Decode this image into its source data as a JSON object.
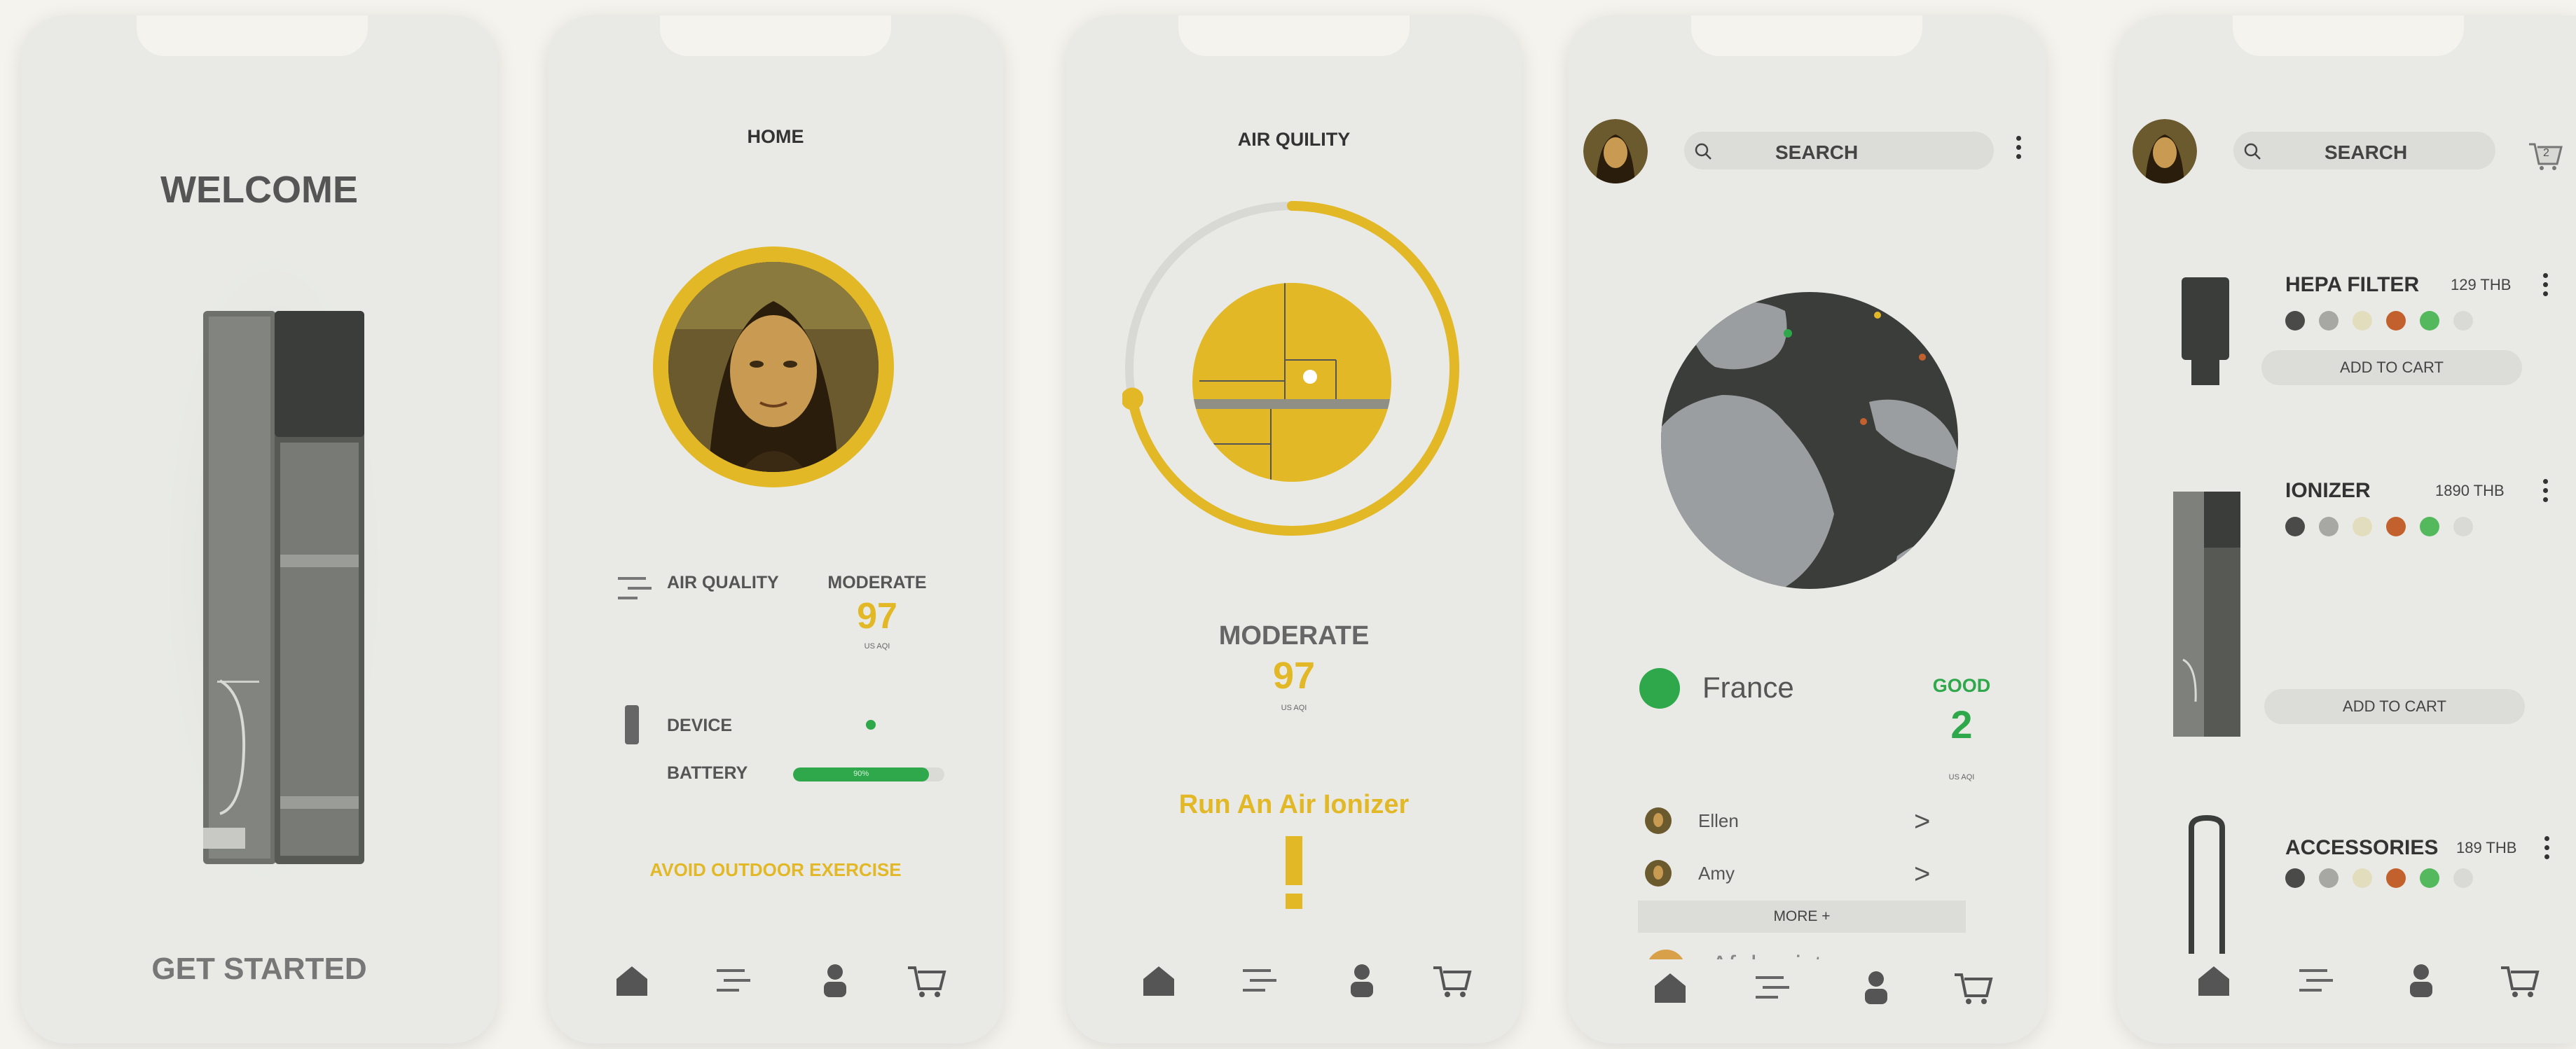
{
  "colors": {
    "accent": "#e2b827",
    "good": "#2ea84a",
    "dark": "#3b3d3a",
    "background": "#f4f3ee",
    "phone": "#e9eae6"
  },
  "welcome": {
    "title": "WELCOME",
    "cta": "GET STARTED"
  },
  "home": {
    "title": "HOME",
    "air_quality_label": "AIR QUALITY",
    "status": "MODERATE",
    "aqi": "97",
    "aqi_unit": "US AQI",
    "device_label": "DEVICE",
    "battery_label": "BATTERY",
    "battery_text": "90%",
    "battery_level": 0.9,
    "advice": "AVOID OUTDOOR EXERCISE"
  },
  "air": {
    "title": "AIR QUILITY",
    "status": "MODERATE",
    "aqi": "97",
    "aqi_unit": "US AQI",
    "action": "Run An Air Ionizer",
    "gauge_level": 0.72
  },
  "map": {
    "search_label": "SEARCH",
    "country": "France",
    "status": "GOOD",
    "aqi": "2",
    "aqi_unit": "US AQI",
    "friends": [
      {
        "name": "Ellen",
        "chevron": ">"
      },
      {
        "name": "Amy",
        "chevron": ">"
      }
    ],
    "more_label": "MORE +",
    "next_country": "Afghanistan"
  },
  "shop": {
    "search_label": "SEARCH",
    "cart_count": "2",
    "add_to_cart": "ADD TO CART",
    "swatches": [
      "#4a4b48",
      "#a7a8a4",
      "#e2ddbc",
      "#c3612e",
      "#54b95d",
      "#d9dad6"
    ],
    "products": [
      {
        "name": "HEPA FILTER",
        "price": "129 THB"
      },
      {
        "name": "IONIZER",
        "price": "1890 THB"
      },
      {
        "name": "ACCESSORIES",
        "price": "189 THB"
      }
    ]
  },
  "nav": {
    "home_icon": "home-icon",
    "list_icon": "menu-lines-icon",
    "user_icon": "user-icon",
    "cart_icon": "cart-icon"
  }
}
